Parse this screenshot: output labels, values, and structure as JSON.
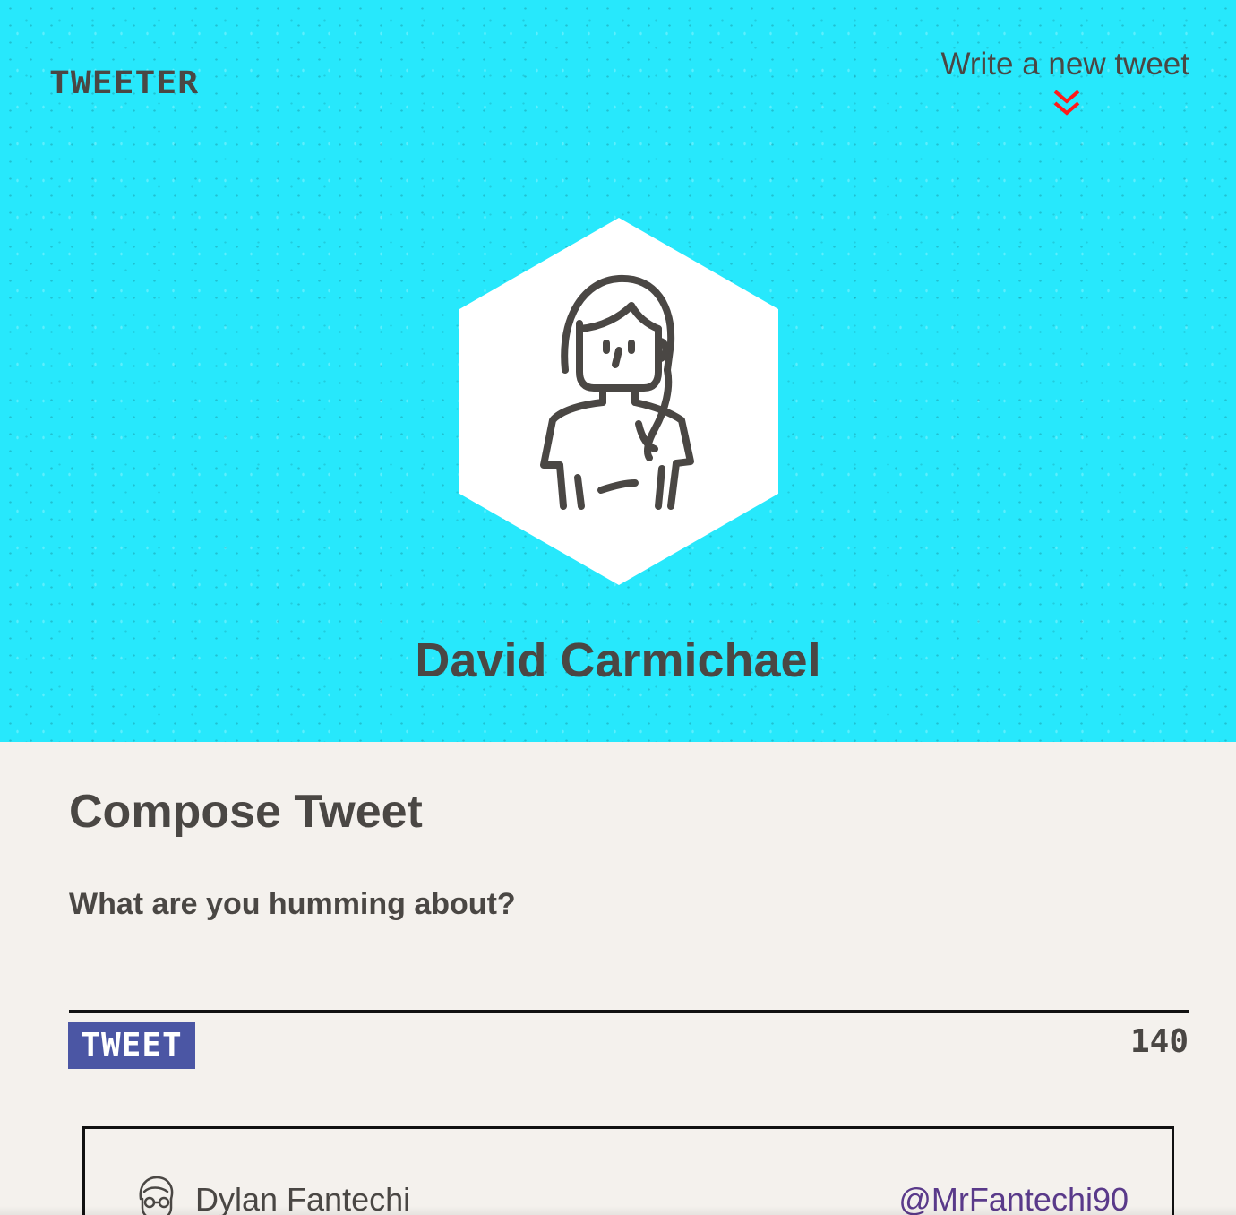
{
  "header": {
    "brand": "TWEETER",
    "write_link": "Write a new tweet",
    "chevron_icon": "double-chevron-down-icon",
    "accent_color": "#ff1a1a",
    "background_color": "#27e8fc"
  },
  "profile": {
    "name": "David Carmichael",
    "avatar_icon": "woman-avatar-icon"
  },
  "compose": {
    "title": "Compose Tweet",
    "label": "What are you humming about?",
    "input_value": "",
    "button_label": "TWEET",
    "button_color": "#4b56a4",
    "char_count": "140"
  },
  "tweets": [
    {
      "author": "Dylan Fantechi",
      "handle": "@MrFantechi90",
      "avatar_icon": "man-avatar-icon"
    }
  ]
}
